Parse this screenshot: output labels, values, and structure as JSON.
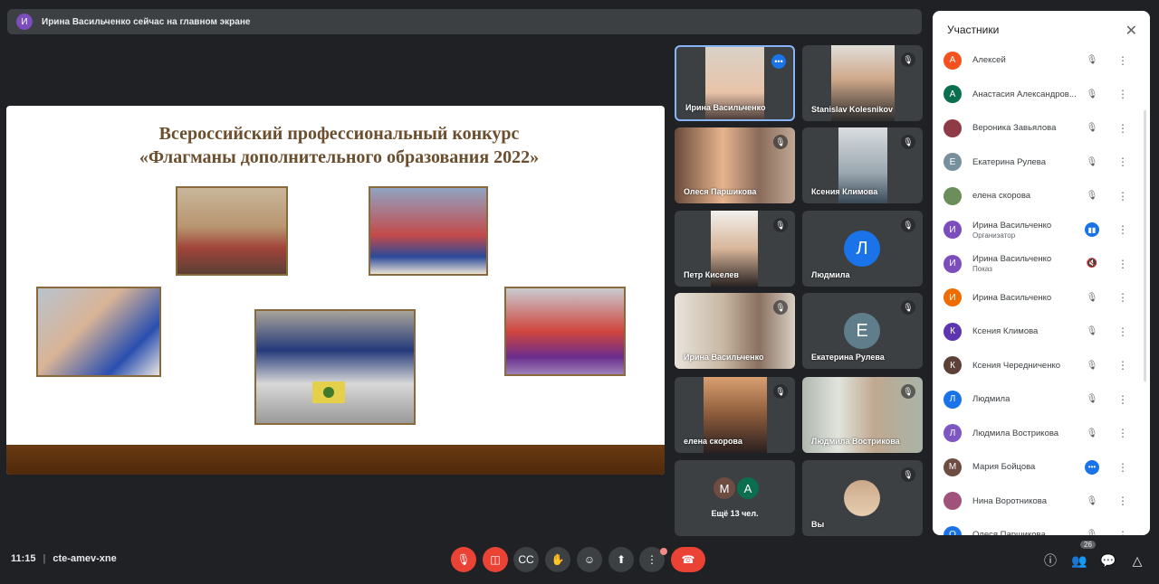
{
  "banner": {
    "avatar": "И",
    "avatar_color": "#7c4dbc",
    "text": "Ирина Васильченко сейчас на главном экране"
  },
  "slide": {
    "title_line1": "Всероссийский профессиональный конкурс",
    "title_line2": "«Флагманы дополнительного образования 2022»"
  },
  "tiles": [
    {
      "name": "Ирина Васильченко",
      "mic": "speaking"
    },
    {
      "name": "Stanislav Kolesnikov",
      "mic": "muted"
    },
    {
      "name": "Олеся Паршикова",
      "mic": "muted"
    },
    {
      "name": "Ксения Климова",
      "mic": "muted"
    },
    {
      "name": "Петр Киселев",
      "mic": "muted"
    },
    {
      "name": "Людмила",
      "mic": "muted",
      "avatar": "Л",
      "avatar_color": "#1a73e8"
    },
    {
      "name": "Ирина Васильченко",
      "mic": "muted"
    },
    {
      "name": "Екатерина Рулева",
      "mic": "muted",
      "avatar": "Е",
      "avatar_color": "#5f7d8b"
    },
    {
      "name": "елена скорова",
      "mic": "muted"
    },
    {
      "name": "Людмила Вострикова",
      "mic": "muted"
    },
    {
      "name": "Ещё 13 чел.",
      "avatars": [
        "М",
        "А"
      ],
      "avatar_colors": [
        "#6d4c41",
        "#0b6e4f"
      ]
    },
    {
      "name": "Вы",
      "mic": "muted"
    }
  ],
  "panel": {
    "title": "Участники",
    "participants": [
      {
        "avatar": "А",
        "color": "#f4511e",
        "name": "Алексей",
        "role": "",
        "mic": "muted"
      },
      {
        "avatar": "А",
        "color": "#0b6e4f",
        "name": "Анастасия Александров...",
        "role": "",
        "mic": "muted"
      },
      {
        "avatar": "",
        "color": "#8e3b46",
        "name": "Вероника Завьялова",
        "role": "",
        "mic": "muted"
      },
      {
        "avatar": "Е",
        "color": "#78909c",
        "name": "Екатерина Рулева",
        "role": "",
        "mic": "muted"
      },
      {
        "avatar": "",
        "color": "#6b8e5a",
        "name": "елена скорова",
        "role": "",
        "mic": "muted"
      },
      {
        "avatar": "И",
        "color": "#7c4dbc",
        "name": "Ирина Васильченко",
        "role": "Организатор",
        "mic": "speaking"
      },
      {
        "avatar": "И",
        "color": "#7c4dbc",
        "name": "Ирина Васильченко",
        "role": "Показ",
        "mic": "present-muted"
      },
      {
        "avatar": "И",
        "color": "#ef6c00",
        "name": "Ирина Васильченко",
        "role": "",
        "mic": "muted"
      },
      {
        "avatar": "К",
        "color": "#5e35b1",
        "name": "Ксения Климова",
        "role": "",
        "mic": "muted"
      },
      {
        "avatar": "К",
        "color": "#5d4037",
        "name": "Ксения Чередниченко",
        "role": "",
        "mic": "muted"
      },
      {
        "avatar": "Л",
        "color": "#1a73e8",
        "name": "Людмила",
        "role": "",
        "mic": "muted"
      },
      {
        "avatar": "Л",
        "color": "#7e57c2",
        "name": "Людмила Вострикова",
        "role": "",
        "mic": "muted"
      },
      {
        "avatar": "М",
        "color": "#6d4c41",
        "name": "Мария Бойцова",
        "role": "",
        "mic": "speaking-dots"
      },
      {
        "avatar": "",
        "color": "#a0527a",
        "name": "Нина Воротникова",
        "role": "",
        "mic": "muted"
      },
      {
        "avatar": "О",
        "color": "#1a73e8",
        "name": "Олеся Паршикова",
        "role": "",
        "mic": "muted"
      }
    ]
  },
  "bottom": {
    "time": "11:15",
    "separator": "|",
    "meeting_code": "cte-amev-xne",
    "participants_count": "26"
  },
  "colors": {
    "background": "#202124",
    "danger": "#ea4335",
    "accent": "#1a73e8"
  },
  "icons": {
    "mic": "mic-off-icon",
    "cam": "videocam-off-icon",
    "cc": "closed-caption-icon",
    "hand": "raise-hand-icon",
    "emoji": "emoji-icon",
    "present": "present-icon",
    "more": "more-vert-icon",
    "hangup": "call-end-icon",
    "info": "info-icon",
    "people": "people-icon",
    "chat": "chat-icon",
    "activities": "activities-icon"
  }
}
